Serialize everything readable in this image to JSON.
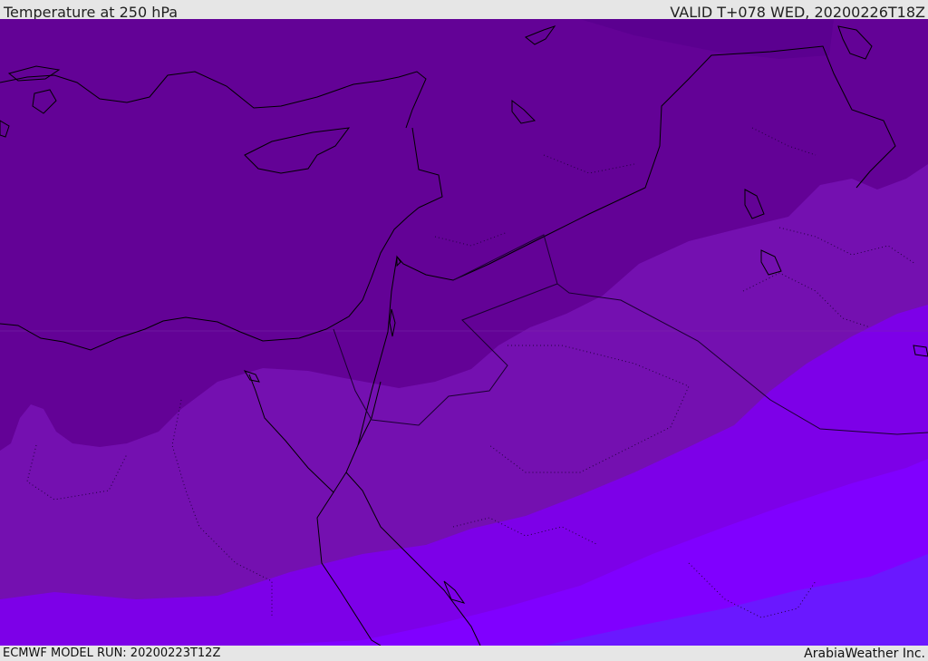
{
  "header": {
    "title": "Temperature at 250 hPa",
    "valid": "VALID T+078 WED, 20200226T18Z"
  },
  "footer": {
    "model_run": "ECMWF MODEL RUN: 20200223T12Z",
    "credit": "ArabiaWeather Inc."
  },
  "map": {
    "field": "temperature",
    "level": "250 hPa",
    "colors": {
      "band_coldest_dark": "#5b0090",
      "band_cold": "#630296",
      "band_mid": "#7410b0",
      "band_warm": "#7d00e8",
      "band_warmer": "#8000ff",
      "band_warmest": "#6a18ff",
      "coastline": "#000000"
    }
  }
}
